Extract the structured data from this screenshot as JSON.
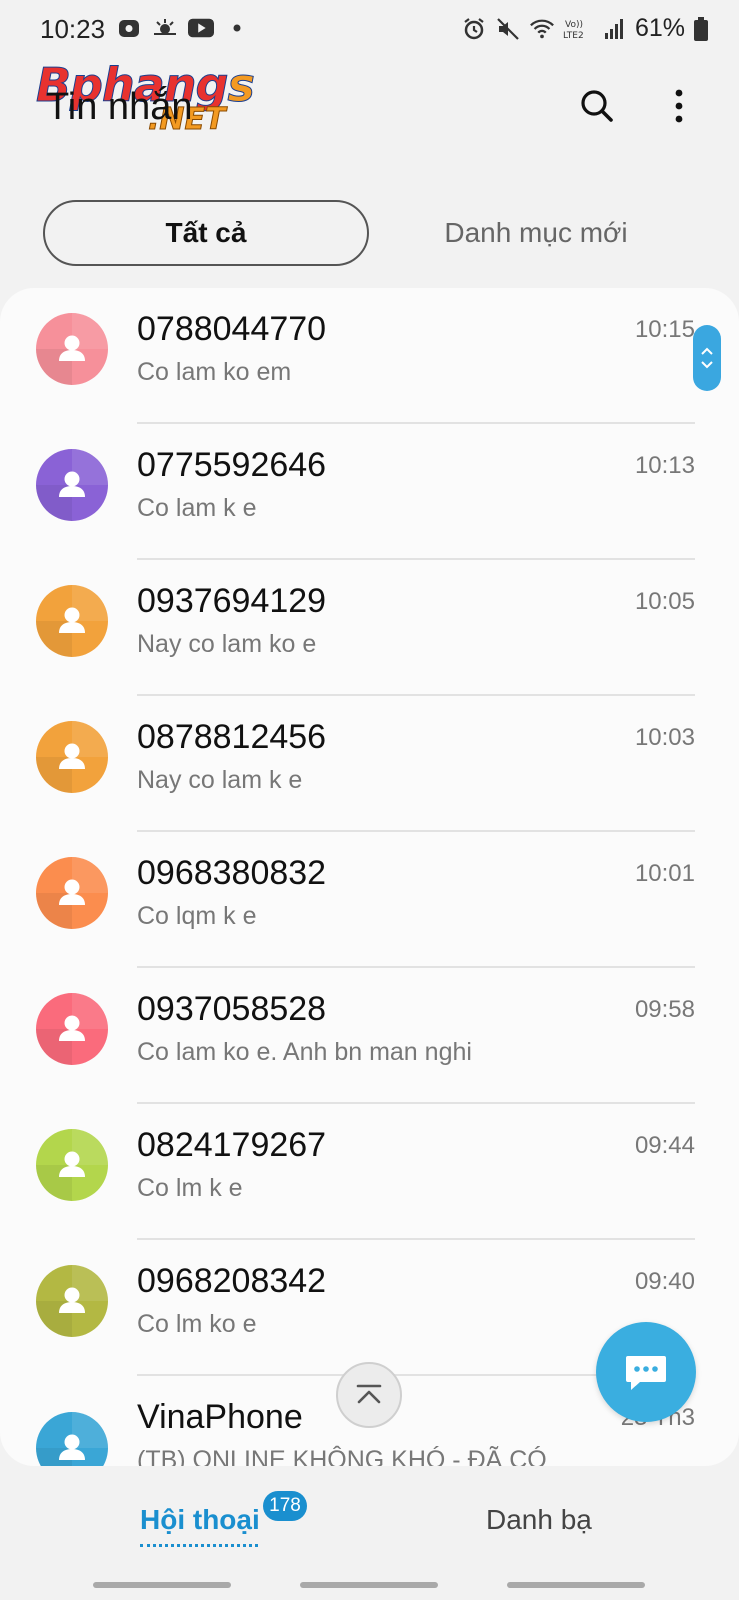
{
  "status": {
    "time": "10:23",
    "battery": "61%",
    "icons_left": [
      "notification-app-icon",
      "weather-icon",
      "youtube-icon",
      "dot-icon"
    ],
    "icons_right": [
      "alarm-icon",
      "mute-icon",
      "wifi-icon",
      "volte-icon",
      "signal-icon",
      "battery-icon"
    ]
  },
  "watermark": {
    "brand_main": "Bphang",
    "brand_s": "s",
    "brand_sub": ".NET"
  },
  "header": {
    "title": "Tin nhắn"
  },
  "tabs": [
    {
      "label": "Tất cả",
      "active": true
    },
    {
      "label": "Danh mục mới",
      "active": false
    }
  ],
  "conversations": [
    {
      "name": "0788044770",
      "preview": "Co lam ko em",
      "time": "10:15",
      "color": "#f6909a"
    },
    {
      "name": "0775592646",
      "preview": "Co lam k e",
      "time": "10:13",
      "color": "#8a62d6"
    },
    {
      "name": "0937694129",
      "preview": "Nay co lam ko e",
      "time": "10:05",
      "color": "#f2a23c"
    },
    {
      "name": "0878812456",
      "preview": "Nay co lam k e",
      "time": "10:03",
      "color": "#f2a23c"
    },
    {
      "name": "0968380832",
      "preview": "Co lqm k e",
      "time": "10:01",
      "color": "#fb8d4e"
    },
    {
      "name": "0937058528",
      "preview": "Co lam ko e.  Anh bn man nghi",
      "time": "09:58",
      "color": "#fa6b7c"
    },
    {
      "name": "0824179267",
      "preview": "Co lm k e",
      "time": "09:44",
      "color": "#b3d64c"
    },
    {
      "name": "0968208342",
      "preview": "Co lm ko e",
      "time": "09:40",
      "color": "#b3b843"
    },
    {
      "name": "VinaPhone",
      "preview": "(TB) ONLINE KHÔNG KHÓ - ĐÃ CÓ",
      "time": "23 Th3",
      "color": "#3aa6d6"
    }
  ],
  "bottom_nav": {
    "conversations_label": "Hội thoại",
    "badge": "178",
    "contacts_label": "Danh bạ"
  },
  "colors": {
    "accent": "#1a8fcf",
    "fab": "#3aaee0"
  }
}
